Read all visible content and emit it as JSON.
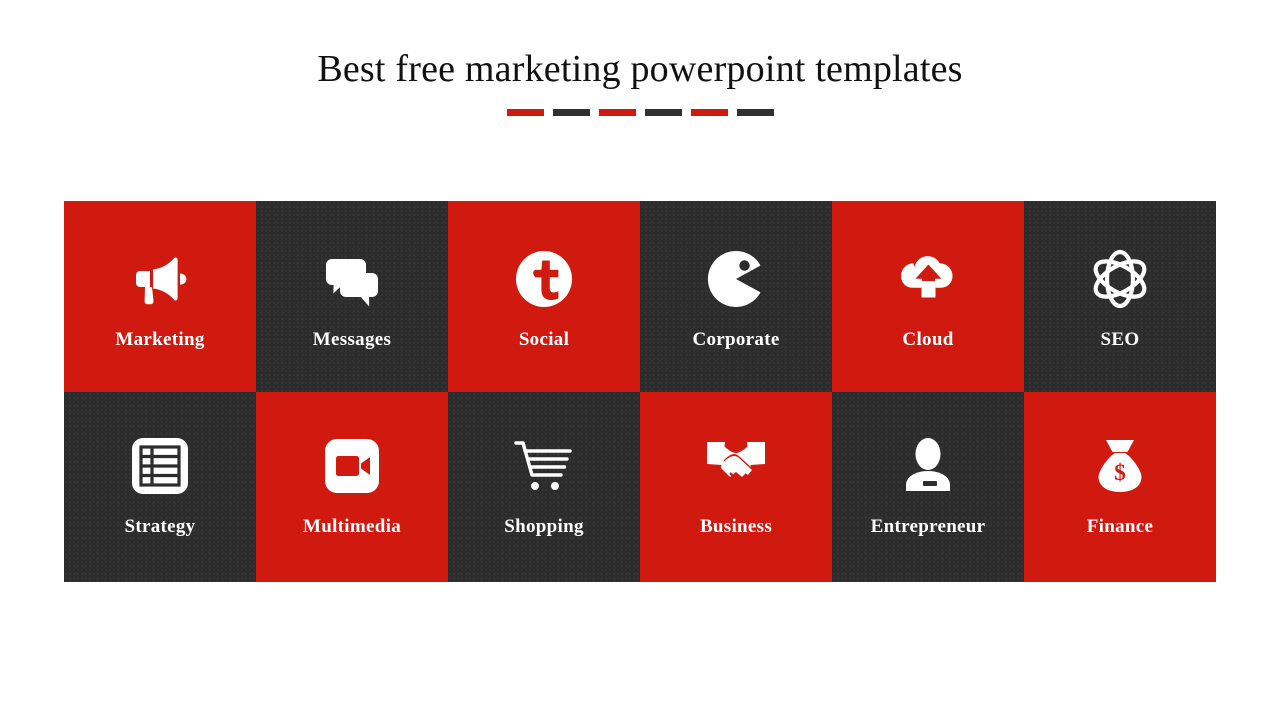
{
  "slide": {
    "title": "Best free marketing powerpoint templates",
    "background_color": "#ffffff",
    "accent_red": "#d11a0f",
    "accent_dark": "#2c2c2c",
    "label_color": "#ffffff",
    "title_color": "#111111"
  },
  "divider": {
    "dashes": [
      {
        "color_name": "red"
      },
      {
        "color_name": "dark"
      },
      {
        "color_name": "red"
      },
      {
        "color_name": "dark"
      },
      {
        "color_name": "red"
      },
      {
        "color_name": "dark"
      }
    ]
  },
  "tiles": [
    {
      "label": "Marketing",
      "icon": "megaphone-icon",
      "tone": "red"
    },
    {
      "label": "Messages",
      "icon": "speech-bubbles-icon",
      "tone": "dark"
    },
    {
      "label": "Social",
      "icon": "twitter-bird-icon",
      "tone": "red"
    },
    {
      "label": "Corporate",
      "icon": "pacman-icon",
      "tone": "dark"
    },
    {
      "label": "Cloud",
      "icon": "cloud-upload-icon",
      "tone": "red"
    },
    {
      "label": "SEO",
      "icon": "atom-icon",
      "tone": "dark"
    },
    {
      "label": "Strategy",
      "icon": "table-list-icon",
      "tone": "dark"
    },
    {
      "label": "Multimedia",
      "icon": "video-camera-icon",
      "tone": "red"
    },
    {
      "label": "Shopping",
      "icon": "shopping-cart-icon",
      "tone": "dark"
    },
    {
      "label": "Business",
      "icon": "handshake-icon",
      "tone": "red"
    },
    {
      "label": "Entrepreneur",
      "icon": "businessman-icon",
      "tone": "dark"
    },
    {
      "label": "Finance",
      "icon": "money-bag-icon",
      "tone": "red"
    }
  ]
}
